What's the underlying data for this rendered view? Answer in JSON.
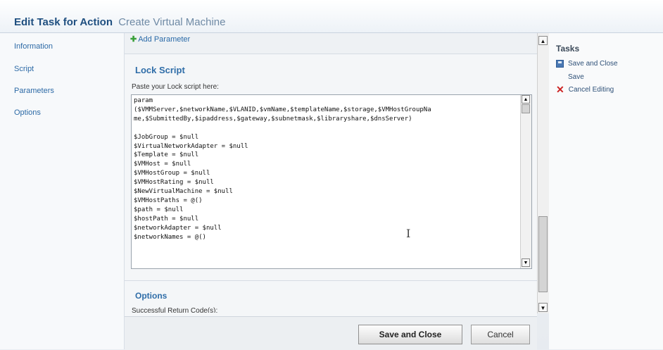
{
  "header": {
    "title_bold": "Edit Task for Action",
    "title_sub": "Create Virtual Machine"
  },
  "leftnav": {
    "items": [
      {
        "label": "Information"
      },
      {
        "label": "Script"
      },
      {
        "label": "Parameters"
      },
      {
        "label": "Options"
      }
    ]
  },
  "main": {
    "add_parameter": "Add Parameter",
    "lock_script": {
      "title": "Lock Script",
      "paste_label": "Paste your Lock script here:",
      "code": "param\n($VMMServer,$networkName,$VLANID,$vmName,$templateName,$storage,$VMHostGroupNa\nme,$SubmittedBy,$ipaddress,$gateway,$subnetmask,$libraryshare,$dnsServer)\n\n$JobGroup = $null\n$VirtualNetworkAdapter = $null\n$Template = $null\n$VMHost = $null\n$VMHostGroup = $null\n$VMHostRating = $null\n$NewVirtualMachine = $null\n$VMHostPaths = @()\n$path = $null\n$hostPath = $null\n$networkAdapter = $null\n$networkNames = @()"
    },
    "options": {
      "title": "Options",
      "return_codes_label": "Successful Return Code(s):"
    }
  },
  "footer": {
    "save_close": "Save and Close",
    "cancel": "Cancel"
  },
  "tasks": {
    "title": "Tasks",
    "save_and_close": "Save and Close",
    "save": "Save",
    "cancel_editing": "Cancel Editing"
  }
}
